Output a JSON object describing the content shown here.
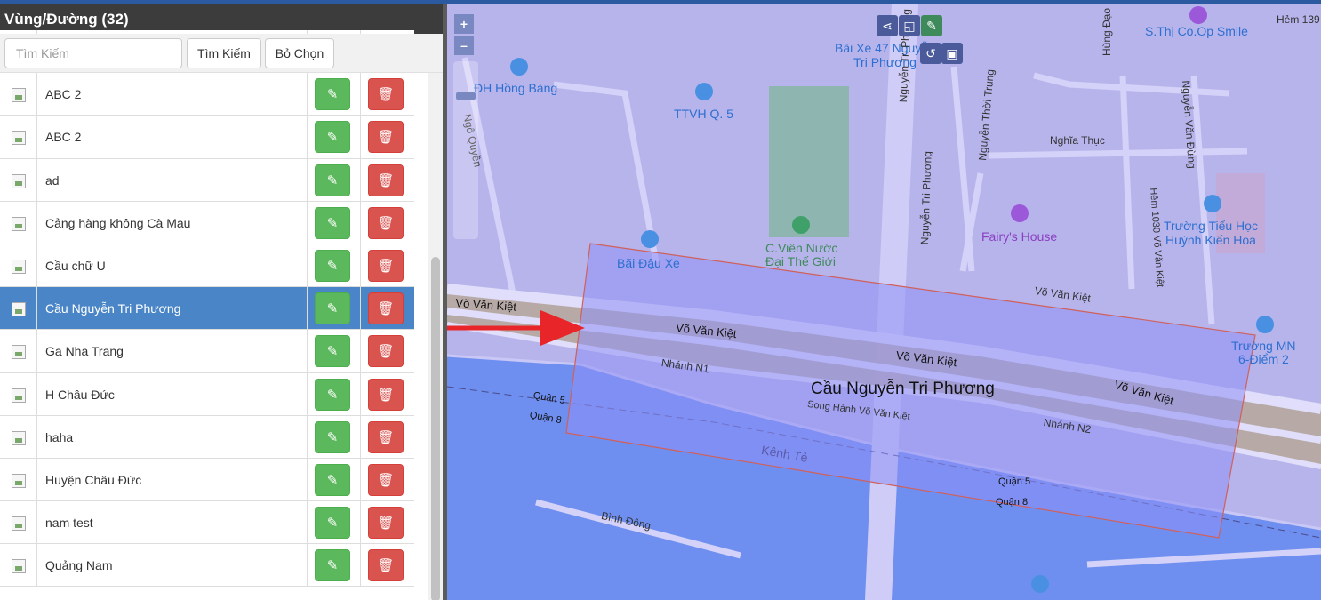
{
  "panel": {
    "title": "Vùng/Đường (32)",
    "search_placeholder": "Tìm Kiếm",
    "search_button": "Tìm Kiếm",
    "clear_button": "Bỏ Chọn",
    "edit_icon": "pencil-square-icon",
    "delete_icon": "trash-icon",
    "items": [
      {
        "name": "",
        "selected": false
      },
      {
        "name": "ABC 2",
        "selected": false
      },
      {
        "name": "ABC 2",
        "selected": false
      },
      {
        "name": "ad",
        "selected": false
      },
      {
        "name": "Cảng hàng không Cà Mau",
        "selected": false
      },
      {
        "name": "Cầu chữ U",
        "selected": false
      },
      {
        "name": "Cầu Nguyễn Tri Phương",
        "selected": true
      },
      {
        "name": "Ga Nha Trang",
        "selected": false
      },
      {
        "name": "H Châu Đức",
        "selected": false
      },
      {
        "name": "haha",
        "selected": false
      },
      {
        "name": "Huyện Châu Đức",
        "selected": false
      },
      {
        "name": "nam test",
        "selected": false
      },
      {
        "name": "Quảng Nam",
        "selected": false
      }
    ]
  },
  "map": {
    "zoom_in": "+",
    "zoom_out": "–",
    "selected_area_label": "Cầu Nguyễn Tri Phương",
    "colors": {
      "background": "#b7b4ec",
      "polygon_fill": "#8f8ff5",
      "polygon_stroke": "#d0605a",
      "arrow": "#e8262a",
      "river": "#6e8ff0"
    },
    "labels": {
      "l1": "ĐH Hồng Bàng",
      "l2": "TTVH Q. 5",
      "l3": "Bãi Xe 47 Nguyễn",
      "l4": "Tri Phương",
      "l5": "S.Thị Co.Op Smile",
      "l6": "Hẻm 139",
      "l7": "Ngô Quyền",
      "l8": "Nguyễn Tri Phương",
      "l9": "Nguyễn Tri Phương",
      "l10": "Nguyễn Thời Trung",
      "l11": "Nghĩa Thục",
      "l12": "Nguyễn Văn Đừng",
      "l13": "Hùng Đạo",
      "l14": "C.Viên Nước",
      "l15": "Đại Thế Giới",
      "l16": "Fairy's House",
      "l17": "Trường Tiểu Học",
      "l18": "Huỳnh Kiến Hoa",
      "l19": "Hẻm 1030 Võ Văn Kiệt",
      "l20": "Bãi Đậu Xe",
      "l21": "Võ Văn Kiệt",
      "l22": "Võ Văn Kiệt",
      "l23": "Võ Văn Kiệt",
      "l24": "Võ Văn Kiệt",
      "l25": "Võ Văn Kiệt",
      "l26": "Trường MN",
      "l27": "6-Điểm 2",
      "l28": "Nhánh N1",
      "l29": "Nhánh N2",
      "l30": "Quận 5",
      "l31": "Quận 8",
      "l32": "Song Hành Võ Văn Kiệt",
      "l33": "Kênh Tẻ",
      "l34": "Quận 5",
      "l35": "Quận 8",
      "l36": "Bình Đông"
    }
  }
}
